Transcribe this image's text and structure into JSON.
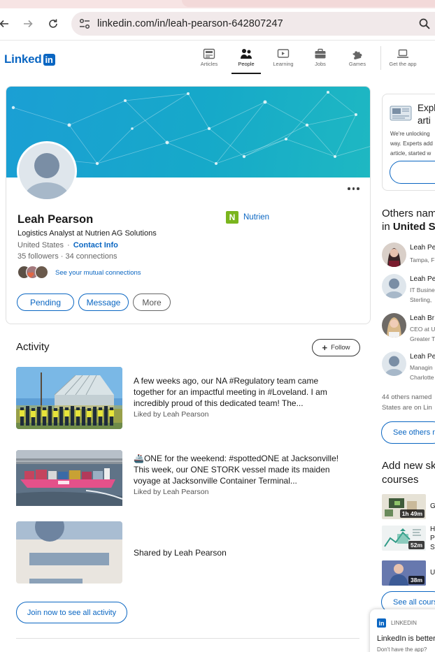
{
  "browser": {
    "url": "linkedin.com/in/leah-pearson-642807247",
    "back_icon": "arrow-left-icon",
    "forward_icon": "arrow-right-icon",
    "reload_icon": "reload-icon",
    "site_info_icon": "tune-icon",
    "zoom_icon": "magnifier-icon"
  },
  "header": {
    "logo_text": "Linked",
    "logo_in": "in",
    "nav": [
      {
        "label": "Articles",
        "icon": "articles-icon"
      },
      {
        "label": "People",
        "icon": "people-icon",
        "active": true
      },
      {
        "label": "Learning",
        "icon": "learning-icon"
      },
      {
        "label": "Jobs",
        "icon": "briefcase-icon"
      },
      {
        "label": "Games",
        "icon": "puzzle-icon"
      },
      {
        "label": "Get the app",
        "icon": "laptop-icon"
      }
    ]
  },
  "profile": {
    "name": "Leah Pearson",
    "headline": "Logistics Analyst at Nutrien AG Solutions",
    "location": "United States",
    "location_sep": "·",
    "contact_info": "Contact Info",
    "followers": "35 followers",
    "followers_sep": "·",
    "connections": "34 connections",
    "mutual": "See your mutual connections",
    "company": "Nutrien",
    "company_logo_letter": "N",
    "buttons": {
      "pending": "Pending",
      "message": "Message",
      "more": "More"
    }
  },
  "activity": {
    "title": "Activity",
    "follow": "Follow",
    "follow_plus": "+",
    "posts": [
      {
        "text": "A few weeks ago, our NA #Regulatory team came together for an impactful meeting in #Loveland. I am incredibly proud of this dedicated team! The...",
        "liked": "Liked by Leah Pearson"
      },
      {
        "text": "🚢ONE for the weekend: #spottedONE at Jacksonville! This week, our ONE STORK vessel made its maiden voyage at Jacksonville Container Terminal...",
        "liked": "Liked by Leah Pearson"
      }
    ],
    "shared": "Shared by Leah Pearson",
    "join": "Join now to see all activity"
  },
  "sidebar": {
    "explore": {
      "title": "Expl\narti",
      "desc": "We're unlocking\nway. Experts add\narticle, started w"
    },
    "others_heading_1": "Others nam",
    "others_heading_2_prefix": "in ",
    "others_heading_2_bold": "United S",
    "people": [
      {
        "name": "Leah Pe",
        "sub1": "Tampa, F",
        "sub2": ""
      },
      {
        "name": "Leah Pe",
        "sub1": "IT Busine",
        "sub2": "Sterling,"
      },
      {
        "name": "Leah Br",
        "sub1": "CEO at U",
        "sub2": "Greater T"
      },
      {
        "name": "Leah Pe",
        "sub1": "Managin",
        "sub2": "Charlotte"
      }
    ],
    "others_note_1": "44 others named",
    "others_note_2": "States are on Lin",
    "see_others": "See others n",
    "courses_heading_1": "Add new sk",
    "courses_heading_2": "courses",
    "courses": [
      {
        "duration": "1h 49m",
        "title_1": "G",
        "title_2": "",
        "title_3": ""
      },
      {
        "duration": "52m",
        "title_1": "H",
        "title_2": "P",
        "title_3": "Sy"
      },
      {
        "duration": "38m",
        "title_1": "U",
        "title_2": "",
        "title_3": ""
      }
    ],
    "see_all_courses": "See all cours",
    "toast": {
      "brand": "LINKEDIN",
      "logo_letter": "in",
      "message": "LinkedIn is better",
      "sub": "Don't have the app?"
    }
  },
  "colors": {
    "brand": "#0a66c2",
    "banner": "#16a9c9",
    "nutrien_green": "#7ab51d"
  }
}
